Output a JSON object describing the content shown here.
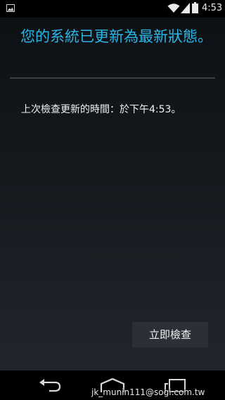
{
  "status_bar": {
    "time": "4:53",
    "icons": [
      "image-icon",
      "wifi-icon",
      "signal-icon",
      "battery-icon"
    ]
  },
  "page": {
    "title": "您的系統已更新為最新狀態。",
    "last_check_text": "上次檢查更新的時間：於下午4:53。",
    "check_button_label": "立即檢查"
  },
  "nav_bar": {
    "icons": [
      "back-icon",
      "home-icon",
      "recents-icon"
    ]
  },
  "watermark": "jk_munin111@sogi.com.tw",
  "colors": {
    "accent": "#2bb5e6",
    "text": "#f2f2f2",
    "button_bg": "#2b3036"
  }
}
